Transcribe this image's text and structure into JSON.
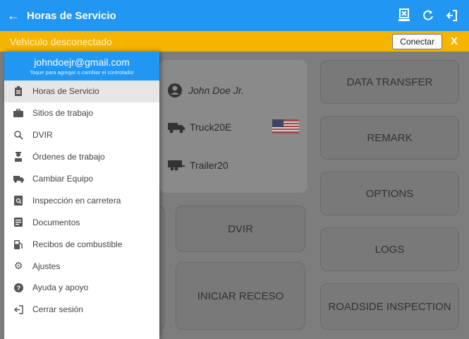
{
  "appbar": {
    "title": "Horas de Servicio"
  },
  "banner": {
    "message": "Vehículo desconectado",
    "connect_label": "Conectar",
    "close_label": "X"
  },
  "drawer": {
    "email": "johndoejr@gmail.com",
    "hint": "Toque para agregar o cambiar el controlador",
    "items": [
      {
        "label": "Horas de Servicio",
        "icon": "clipboard-icon"
      },
      {
        "label": "Sitios de trabajo",
        "icon": "briefcase-icon"
      },
      {
        "label": "DVIR",
        "icon": "search-icon"
      },
      {
        "label": "Órdenes de trabajo",
        "icon": "worker-icon"
      },
      {
        "label": "Cambiar Equipo",
        "icon": "truck-icon"
      },
      {
        "label": "Inspección en carretera",
        "icon": "inspection-icon"
      },
      {
        "label": "Documentos",
        "icon": "document-icon"
      },
      {
        "label": "Recibos de combustible",
        "icon": "fuel-icon"
      },
      {
        "label": "Ajustes",
        "icon": "gear-icon"
      },
      {
        "label": "Ayuda y apoyo",
        "icon": "help-icon"
      },
      {
        "label": "Cerrar sesión",
        "icon": "logout-icon"
      }
    ]
  },
  "info": {
    "driver": "John Doe Jr.",
    "truck": "Truck20E",
    "trailer": "Trailer20"
  },
  "tiles": {
    "data_transfer": "DATA TRANSFER",
    "remark": "REMARK",
    "options": "OPTIONS",
    "logs": "LOGS",
    "roadside": "ROADSIDE INSPECTION",
    "dvir": "DVIR",
    "iniciar_receso": "INICIAR RECESO"
  },
  "colors": {
    "primary": "#2196f3",
    "warning": "#f5b400"
  }
}
